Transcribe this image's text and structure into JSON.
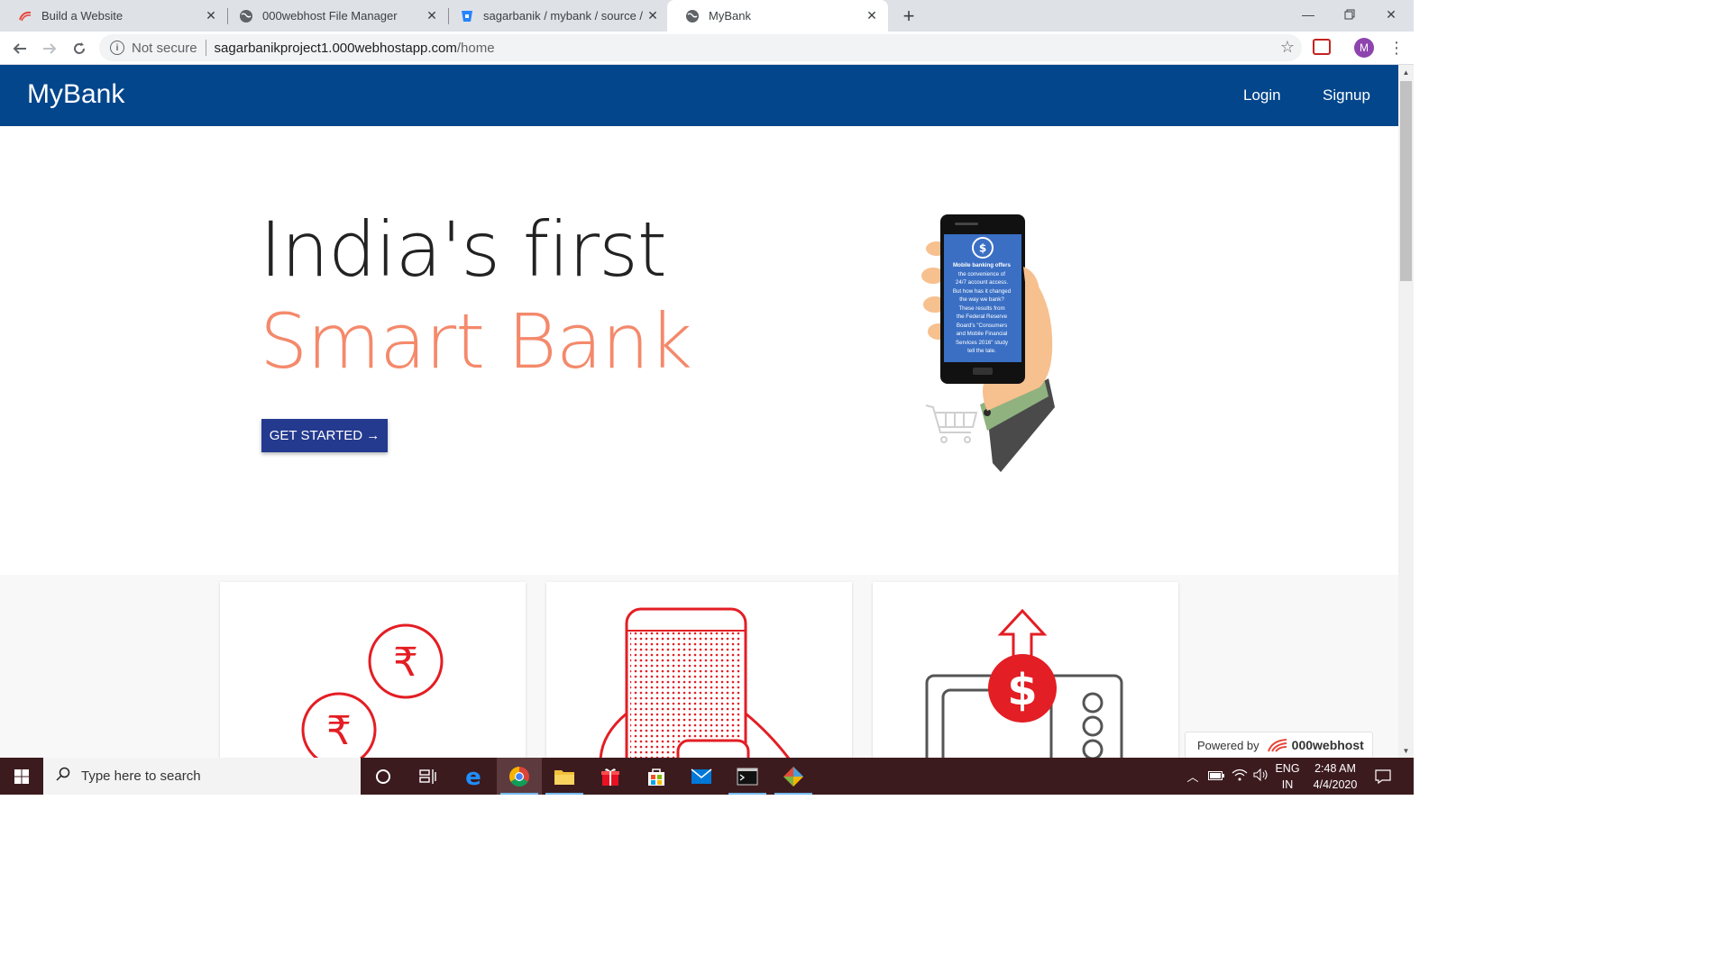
{
  "browser": {
    "tabs": [
      {
        "title": "Build a Website",
        "active": false
      },
      {
        "title": "000webhost File Manager",
        "active": false
      },
      {
        "title": "sagarbanik / mybank / source / R",
        "active": false
      },
      {
        "title": "MyBank",
        "active": true
      }
    ],
    "address": {
      "security": "Not secure",
      "host": "sagarbanikproject1.000webhostapp.com",
      "path": "/home"
    },
    "profile_initial": "M"
  },
  "site": {
    "brand": "MyBank",
    "nav": {
      "login": "Login",
      "signup": "Signup"
    },
    "hero": {
      "line1": "India's first",
      "line2": "Smart Bank",
      "cta": "GET STARTED →"
    },
    "phone_text": [
      "Mobile banking offers",
      "the convenience of",
      "24/7 account access.",
      "But how has it changed",
      "the way we bank?",
      "These results from",
      "the Federal Reserve",
      "Board's \"Consumers",
      "and Mobile Financial",
      "Services 2016\" study",
      "tell the tale."
    ],
    "powered": {
      "label": "Powered by",
      "brand": "000webhost"
    }
  },
  "taskbar": {
    "search_placeholder": "Type here to search",
    "lang": {
      "line1": "ENG",
      "line2": "IN"
    },
    "time": "2:48 AM",
    "date": "4/4/2020"
  },
  "colors": {
    "navbar": "#03468c",
    "accent": "#f4896b",
    "cta": "#243a8f",
    "icon_red": "#e31e24"
  }
}
